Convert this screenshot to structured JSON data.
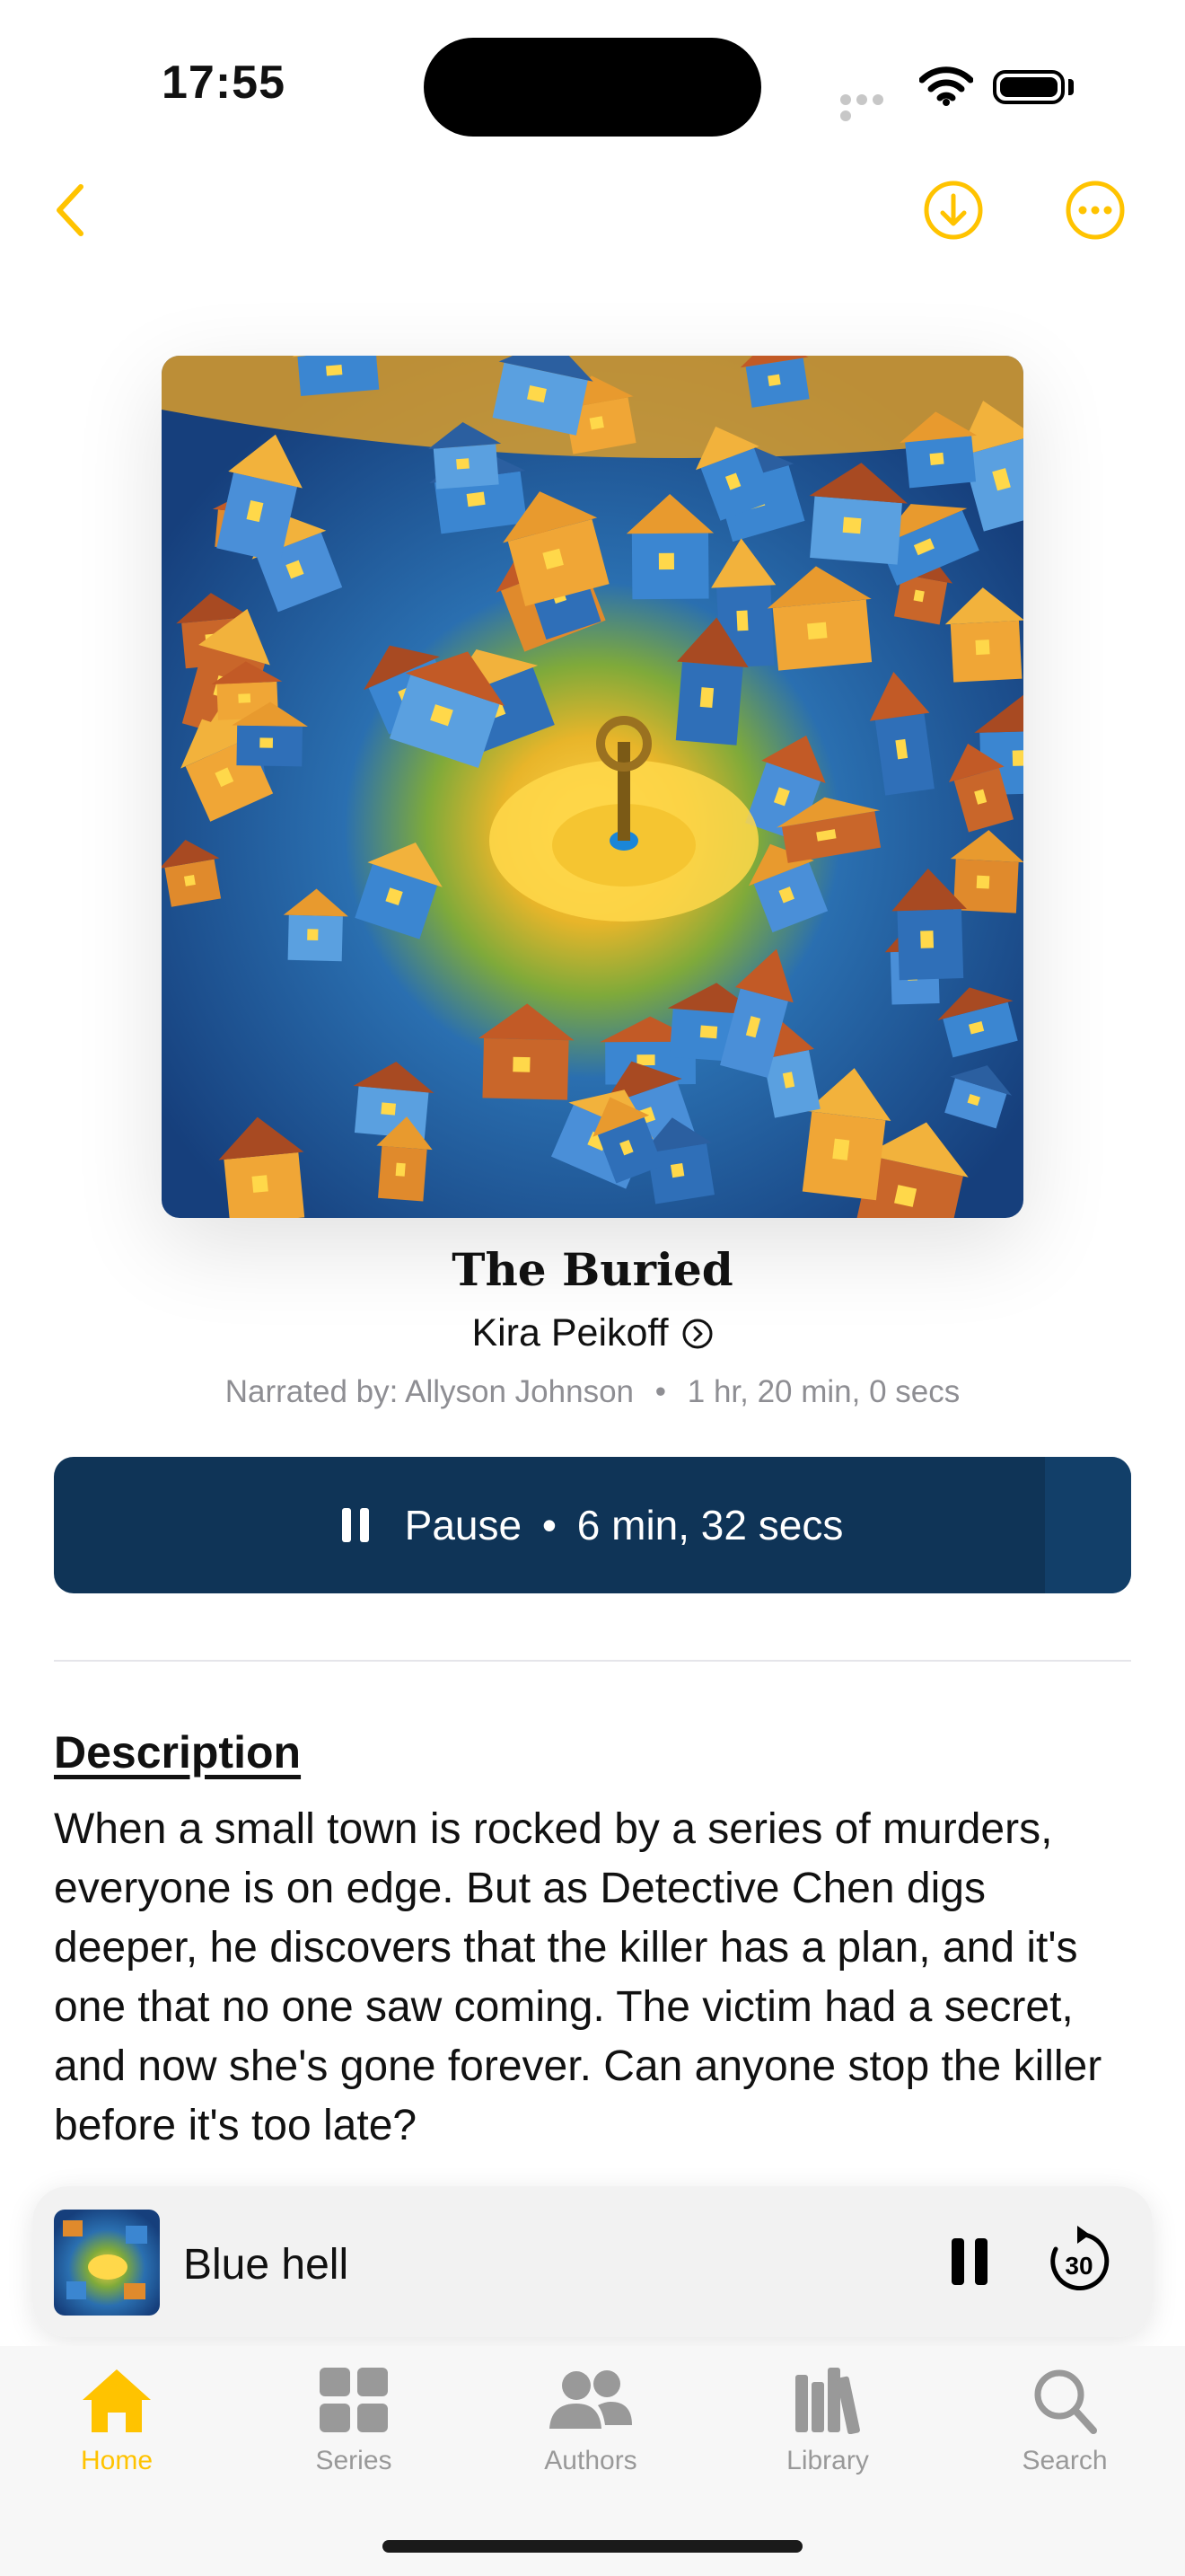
{
  "status_bar": {
    "time": "17:55"
  },
  "colors": {
    "accent": "#FFC300",
    "play_button": "#0F3457",
    "play_button_progress": "#123F69",
    "secondary_text": "#8E8E93"
  },
  "nav": {
    "back_icon": "chevron-left-icon",
    "download_icon": "download-icon",
    "more_icon": "ellipsis-icon"
  },
  "book": {
    "title": "The Buried",
    "author": "Kira Peikoff",
    "narrator_line": "Narrated by: Allyson Johnson",
    "separator": "•",
    "duration": "1 hr, 20 min, 0 secs"
  },
  "play_button": {
    "label": "Pause",
    "separator": "•",
    "remaining": "6 min, 32 secs",
    "progress_fraction": 0.08
  },
  "description": {
    "heading": "Description",
    "text": "When a small town is rocked by a series of murders, everyone is on edge. But as Detective Chen digs deeper, he discovers that the killer has a plan, and it's one that no one saw coming. The victim had a secret, and now she's gone forever. Can anyone stop the killer before it's too late?"
  },
  "mini_player": {
    "title": "Blue hell",
    "skip_label": "30"
  },
  "tabs": [
    {
      "label": "Home",
      "icon": "house-icon",
      "active": true
    },
    {
      "label": "Series",
      "icon": "grid-icon",
      "active": false
    },
    {
      "label": "Authors",
      "icon": "people-icon",
      "active": false
    },
    {
      "label": "Library",
      "icon": "books-icon",
      "active": false
    },
    {
      "label": "Search",
      "icon": "magnifier-icon",
      "active": false
    }
  ]
}
